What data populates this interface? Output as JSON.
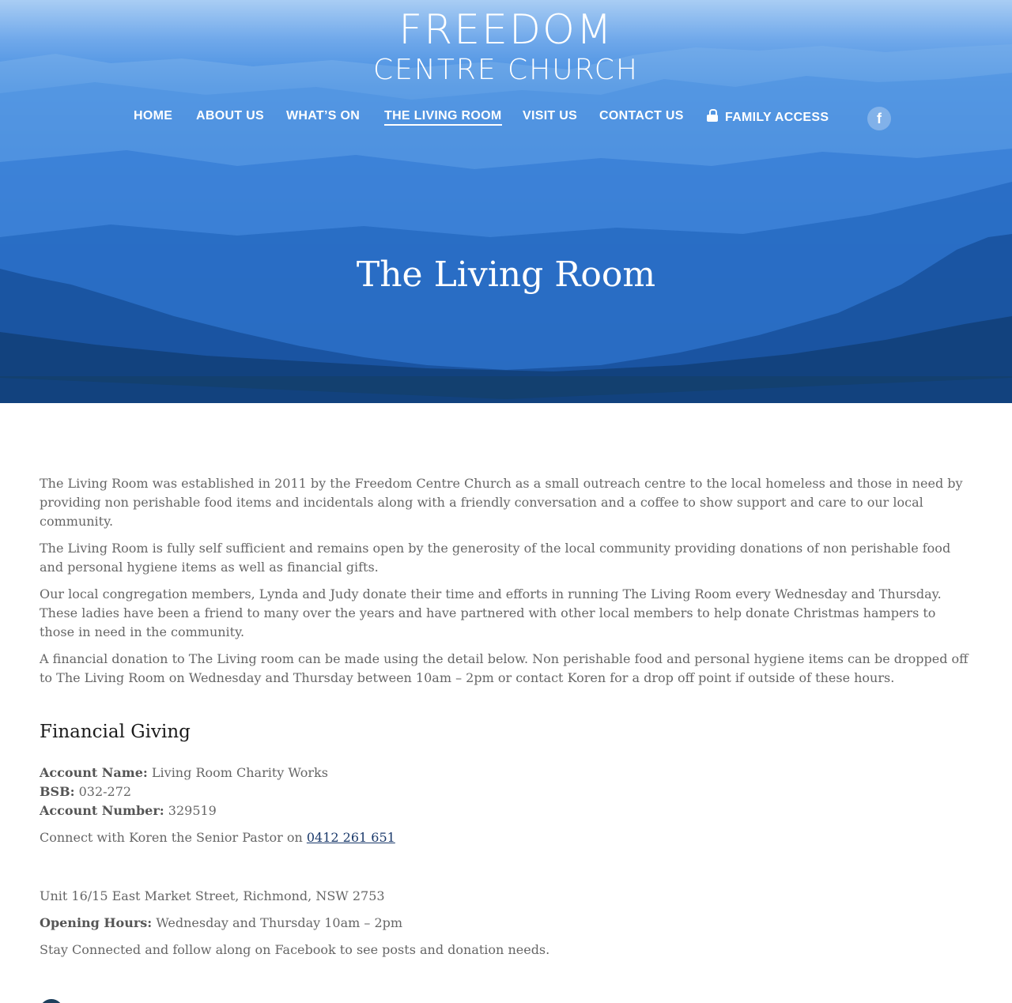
{
  "brand": {
    "line1": "FREEDOM",
    "line2": "CENTRE CHURCH"
  },
  "nav": {
    "items": [
      {
        "label": "HOME"
      },
      {
        "label": "ABOUT US"
      },
      {
        "label": "WHAT’S ON"
      },
      {
        "label": "THE LIVING ROOM",
        "active": true
      },
      {
        "label": "VISIT US"
      },
      {
        "label": "CONTACT US"
      },
      {
        "label": "FAMILY ACCESS",
        "icon": "lock-icon"
      }
    ],
    "social": {
      "icon": "facebook-icon",
      "glyph": "f"
    }
  },
  "hero": {
    "title": "The Living Room"
  },
  "colors": {
    "divider": "#13406f",
    "link": "#1b3a6b",
    "heading": "#1a1a1a",
    "body_text": "#666666"
  },
  "content": {
    "paragraphs": [
      "The Living Room was established in 2011 by the Freedom Centre Church as a small outreach centre to the local homeless and those in need by providing non perishable food items and incidentals along with a friendly conversation and a coffee to show support and care to our local community.",
      "The Living Room is fully self sufficient and remains open by the generosity of the local community providing donations of non perishable food and personal hygiene items as well as financial gifts.",
      "Our local congregation members, Lynda and Judy donate their time and efforts in running The Living Room every Wednesday and Thursday. These ladies have been a friend to many over the years and have partnered with other local members to help donate Christmas hampers to those in need in the community.",
      "A financial donation to The Living room can be made using the detail below. Non perishable food and personal hygiene items can be dropped off to The Living Room on Wednesday and Thursday between 10am – 2pm or contact Koren for a drop off point if outside of these hours."
    ],
    "giving_heading": "Financial Giving",
    "account_name_label": "Account Name:",
    "account_name": "Living Room Charity Works",
    "bsb_label": "BSB:",
    "bsb": "032-272",
    "account_number_label": "Account Number:",
    "account_number": "329519",
    "connect_text": "Connect with Koren the Senior Pastor on",
    "phone": "0412 261 651",
    "address": "Unit 16/15 East Market Street, Richmond, NSW 2753",
    "hours_label": "Opening Hours:",
    "hours": "Wednesday and Thursday 10am – 2pm",
    "stay_connected": "Stay Connected and follow along on Facebook to see posts and donation needs."
  }
}
